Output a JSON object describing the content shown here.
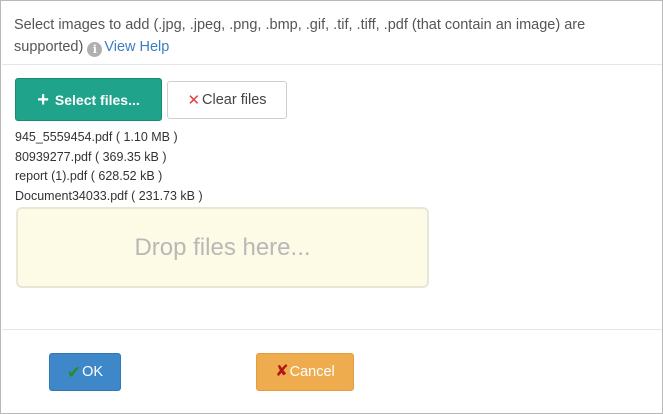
{
  "dialog": {
    "info_text": "Select images to add (.jpg, .jpeg, .png, .bmp, .gif, .tif, .tiff, .pdf (that contain an image) are supported)",
    "info_icon_glyph": "i",
    "help_link_label": "View Help"
  },
  "toolbar": {
    "select_label": "Select files...",
    "clear_label": "Clear files",
    "select_icon": "plus-icon",
    "clear_icon": "x-icon"
  },
  "files": [
    {
      "name": "945_5559454.pdf",
      "size": "( 1.10 MB )"
    },
    {
      "name": "80939277.pdf",
      "size": "( 369.35 kB )"
    },
    {
      "name": "report (1).pdf",
      "size": "( 628.52 kB )"
    },
    {
      "name": "Document34033.pdf",
      "size": "( 231.73 kB )"
    }
  ],
  "drop_zone": {
    "label": "Drop files here..."
  },
  "footer": {
    "ok_label": "OK",
    "cancel_label": "Cancel",
    "ok_icon": "check-icon",
    "cancel_icon": "x-icon"
  },
  "colors": {
    "select_button": "#1fa38a",
    "ok_button": "#3e87c9",
    "cancel_button": "#efac4e",
    "drop_zone": "#fdfbe5",
    "link": "#3a7fc1"
  }
}
